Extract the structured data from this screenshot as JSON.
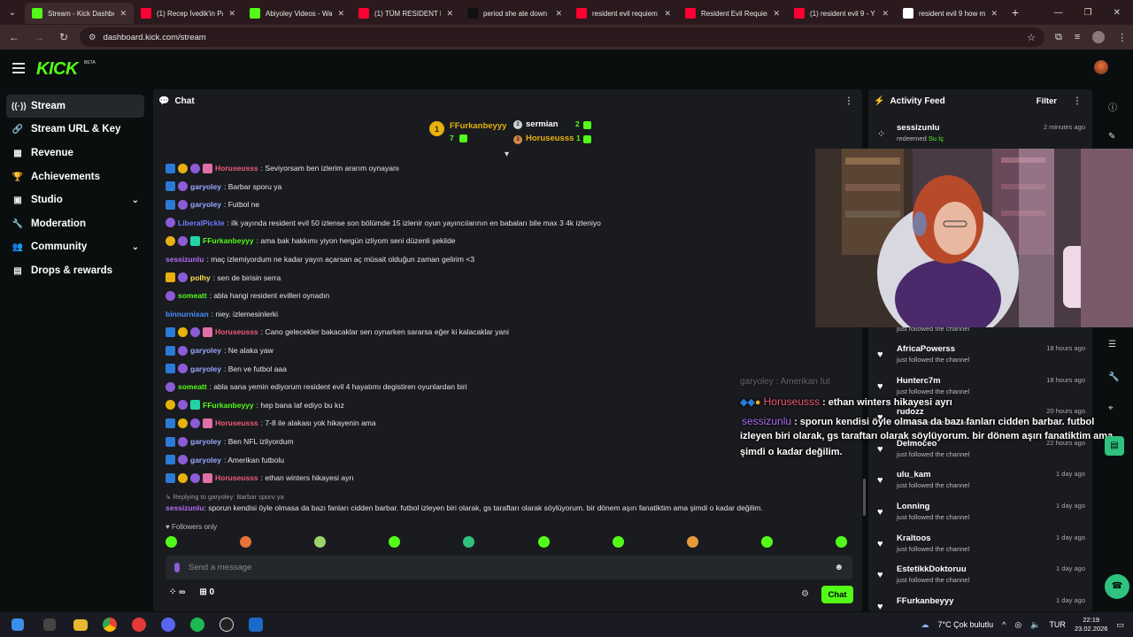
{
  "browser": {
    "tabs": [
      {
        "title": "Stream - Kick Dashbo",
        "icon": "kick-icon",
        "color": "#53fc18",
        "active": true
      },
      {
        "title": "(1) Recep İvedik'in Pa",
        "icon": "youtube-icon",
        "color": "#ff0033"
      },
      {
        "title": "Abiyoley Videos - Wa",
        "icon": "kick-icon",
        "color": "#53fc18"
      },
      {
        "title": "(1) TÜM RESIDENT EV",
        "icon": "youtube-icon",
        "color": "#ff0033"
      },
      {
        "title": "period she ate down",
        "icon": "tiktok-icon",
        "color": "#111111"
      },
      {
        "title": "resident evil requiem",
        "icon": "youtube-icon",
        "color": "#ff0033"
      },
      {
        "title": "Resident Evil Requien",
        "icon": "youtube-icon",
        "color": "#ff0033"
      },
      {
        "title": "(1) resident evil 9 - Y",
        "icon": "youtube-icon",
        "color": "#ff0033"
      },
      {
        "title": "resident evil 9 how m",
        "icon": "google-icon",
        "color": "#ffffff"
      }
    ],
    "url": "dashboard.kick.com/stream"
  },
  "app": {
    "logo": "KICK",
    "beta": "BETA"
  },
  "sidebar": {
    "items": [
      {
        "label": "Stream",
        "icon": "broadcast-icon",
        "glyph": "((·))",
        "active": true
      },
      {
        "label": "Stream URL & Key",
        "icon": "link-icon",
        "glyph": "🔗"
      },
      {
        "label": "Revenue",
        "icon": "revenue-icon",
        "glyph": "▦"
      },
      {
        "label": "Achievements",
        "icon": "trophy-icon",
        "glyph": "🏆"
      },
      {
        "label": "Studio",
        "icon": "studio-icon",
        "glyph": "▣",
        "chevron": true
      },
      {
        "label": "Moderation",
        "icon": "wrench-icon",
        "glyph": "🔧"
      },
      {
        "label": "Community",
        "icon": "community-icon",
        "glyph": "👥",
        "chevron": true
      },
      {
        "label": "Drops & rewards",
        "icon": "drops-icon",
        "glyph": "▤"
      }
    ]
  },
  "chat": {
    "title": "Chat",
    "leaderboard": [
      {
        "name": "FFurkanbeyyy",
        "count": "7"
      },
      {
        "name": "sermian",
        "count": "2"
      },
      {
        "name": "Horuseusss",
        "count": "1"
      }
    ],
    "messages": [
      {
        "badges": [
          "mod",
          "og",
          "sub",
          "gift"
        ],
        "user": "Horuseusss",
        "color": "#f05a78",
        "text": ": Seviyorsam ben izlerim ararım oynayanı"
      },
      {
        "badges": [
          "mod",
          "sub"
        ],
        "user": "garyoley",
        "color": "#9aa7ff",
        "text": ": Barbar sporu ya"
      },
      {
        "badges": [
          "mod",
          "sub"
        ],
        "user": "garyoley",
        "color": "#9aa7ff",
        "text": ": Futbol ne"
      },
      {
        "badges": [
          "sub"
        ],
        "user": "LiberalPickle",
        "color": "#6f7cff",
        "text": ": ilk yayında resident evil 50 izlense son bölümde 15 izlenir oyun yayıncılarının en babaları bile max 3 4k izleniyo"
      },
      {
        "badges": [
          "og",
          "sub",
          "gg"
        ],
        "user": "FFurkanbeyyy",
        "color": "#53fc18",
        "text": ": ama bak hakkımı yiyon hergün izliyom seni düzenli şekilde"
      },
      {
        "badges": [],
        "user": "sessizunlu",
        "color": "#b46cf5",
        "text": ": maç izlemiyordum ne kadar yayın açarsan aç müsait olduğun zaman gelirim <3"
      },
      {
        "badges": [
          "vip",
          "sub"
        ],
        "user": "polhy",
        "color": "#ffe14d",
        "text": ": sen de birisin serra"
      },
      {
        "badges": [
          "sub"
        ],
        "user": "someatt",
        "color": "#53fc18",
        "text": ": abla hangi resident evilleri oynadın"
      },
      {
        "badges": [],
        "user": "binnurnisan",
        "color": "#4d8cff",
        "text": ": niey. izlemesinlerki"
      },
      {
        "badges": [
          "mod",
          "og",
          "sub",
          "gift"
        ],
        "user": "Horuseusss",
        "color": "#f05a78",
        "text": ": Cano gelecekler bakacaklar sen oynarken sararsa eğer ki kalacaklar yani"
      },
      {
        "badges": [
          "mod",
          "sub"
        ],
        "user": "garyoley",
        "color": "#9aa7ff",
        "text": ": Ne alaka yaw"
      },
      {
        "badges": [
          "mod",
          "sub"
        ],
        "user": "garyoley",
        "color": "#9aa7ff",
        "text": ": Ben ve futbol aaa"
      },
      {
        "badges": [
          "sub"
        ],
        "user": "someatt",
        "color": "#53fc18",
        "text": ": abla sana yemin ediyorum resident evil 4 hayatımı degistiren oyunlardan biri"
      },
      {
        "badges": [
          "og",
          "sub",
          "gg"
        ],
        "user": "FFurkanbeyyy",
        "color": "#53fc18",
        "text": ": hep bana laf ediyo bu kız"
      },
      {
        "badges": [
          "mod",
          "og",
          "sub",
          "gift"
        ],
        "user": "Horuseusss",
        "color": "#f05a78",
        "text": ": 7-8 ile alakası yok hikayenin ama"
      },
      {
        "badges": [
          "mod",
          "sub"
        ],
        "user": "garyoley",
        "color": "#9aa7ff",
        "text": ": Ben NFL izliyordum"
      },
      {
        "badges": [
          "mod",
          "sub"
        ],
        "user": "garyoley",
        "color": "#9aa7ff",
        "text": ": Amerikan futbolu"
      },
      {
        "badges": [
          "mod",
          "og",
          "sub",
          "gift"
        ],
        "user": "Horuseusss",
        "color": "#f05a78",
        "text": ": ethan winters hikayesi ayrı"
      }
    ],
    "reply_to": "↳ Replying to garyoley: Barbar sporu ya",
    "reply_user": "sessizunlu",
    "reply_text": ": sporun kendisi öyle olmasa da bazı fanları cidden barbar. futbol izleyen biri olarak, gs taraftarı olarak söylüyorum. bir dönem aşırı fanatiktim ama şimdi o kadar değilim.",
    "followers_only": "Followers only",
    "placeholder": "Send a message",
    "points": "∞",
    "gift_count": "0",
    "send_label": "Chat"
  },
  "overlay": {
    "faded": "garyoley : Amerikan fut",
    "line1_user": "Horuseusss",
    "line1_text": " : ethan winters hikayesi ayrı",
    "line2_user": "sessizunlu",
    "line2_text": " : sporun kendisi öyle olmasa da bazı fanları cidden barbar. futbol",
    "line3": "izleyen biri olarak, gs taraftarı olarak söylüyorum. bir dönem aşırı fanatiktim ama",
    "line4": "şimdi o kadar değilim."
  },
  "feed": {
    "title": "Activity Feed",
    "filter": "Filter",
    "top": {
      "name": "sessizunlu",
      "action": "redeemed",
      "reward": "Su İç",
      "time": "2 minutes ago"
    },
    "partial_label": "just followed the channel",
    "items": [
      {
        "name": "AfricaPowerss",
        "action": "just followed the channel",
        "time": "18 hours ago"
      },
      {
        "name": "Hunterc7m",
        "action": "just followed the channel",
        "time": "18 hours ago"
      },
      {
        "name": "rudozz",
        "action": "just followed the channel",
        "time": "20 hours ago"
      },
      {
        "name": "Delmoceo",
        "action": "just followed the channel",
        "time": "22 hours ago"
      },
      {
        "name": "ulu_kam",
        "action": "just followed the channel",
        "time": "1 day ago"
      },
      {
        "name": "Lonning",
        "action": "just followed the channel",
        "time": "1 day ago"
      },
      {
        "name": "Kraltoos",
        "action": "just followed the channel",
        "time": "1 day ago"
      },
      {
        "name": "EstetikkDoktoruu",
        "action": "just followed the channel",
        "time": "1 day ago"
      },
      {
        "name": "FFurkanbeyyy",
        "action": "",
        "time": "1 day ago"
      }
    ]
  },
  "taskbar": {
    "weather": "7°C  Çok bulutlu",
    "lang": "TUR",
    "time": "22:19",
    "date": "23.02.2026"
  }
}
